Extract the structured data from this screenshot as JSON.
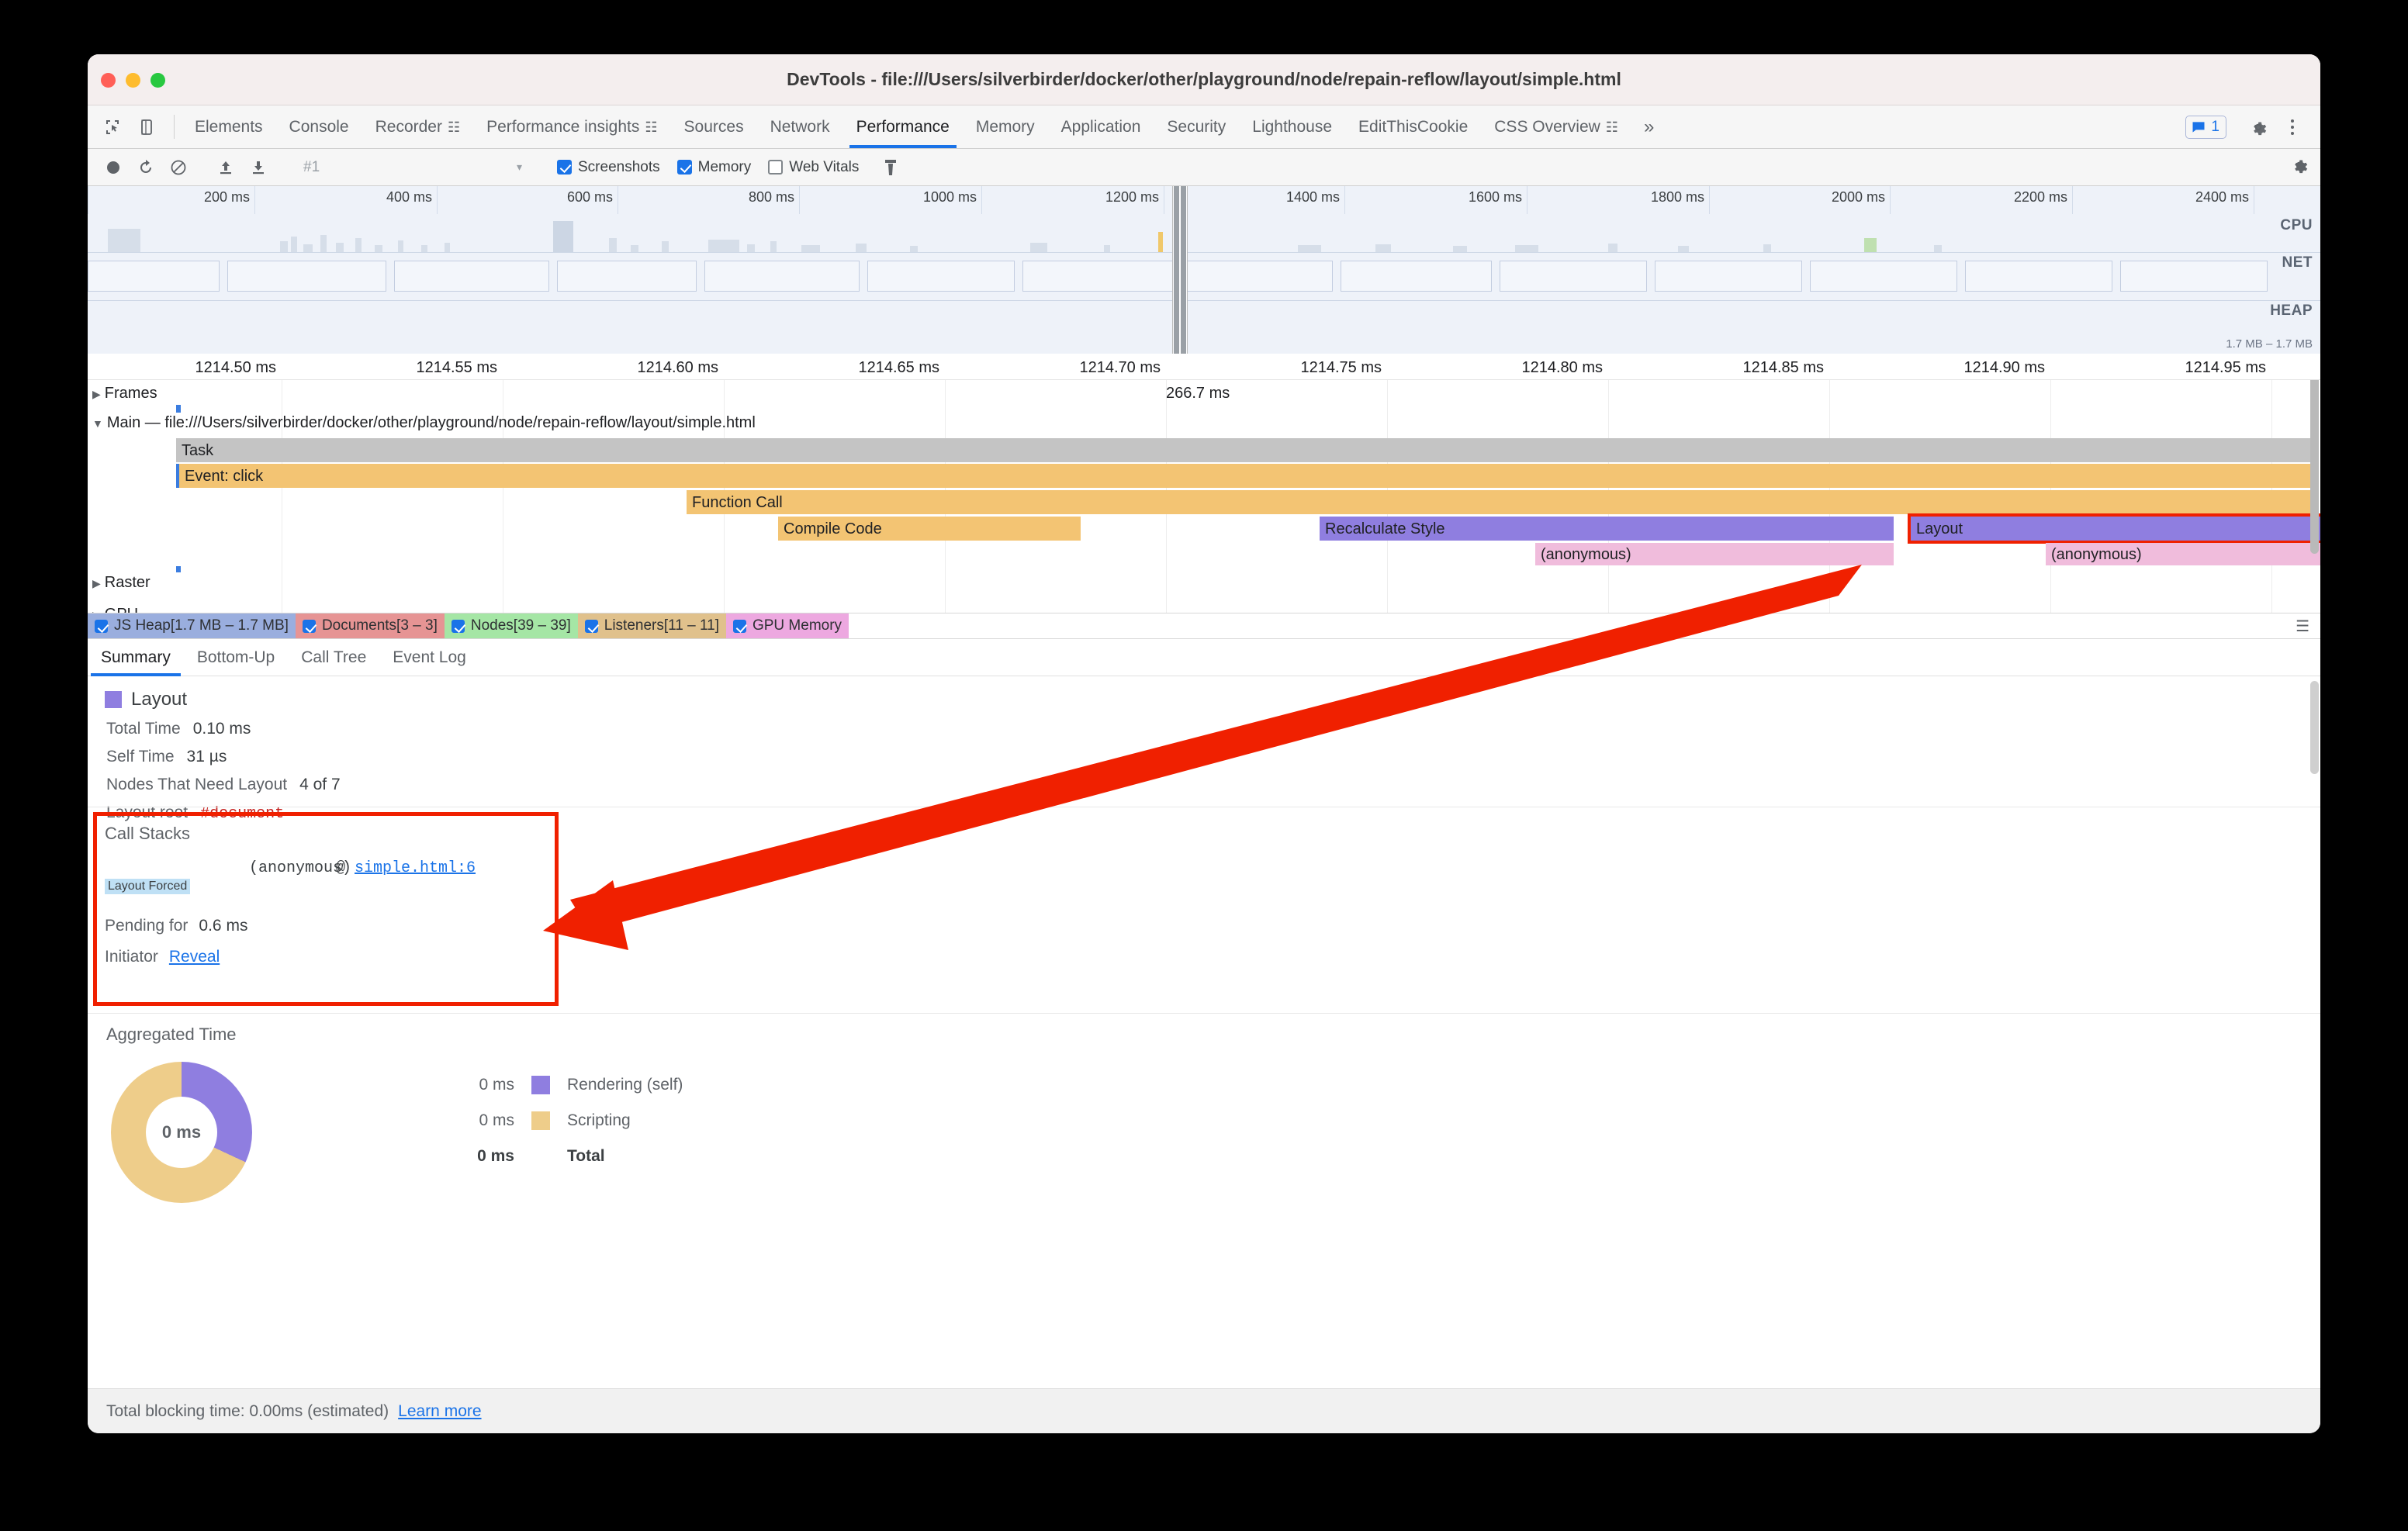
{
  "window": {
    "title": "DevTools - file:///Users/silverbirder/docker/other/playground/node/repain-reflow/layout/simple.html",
    "traffic_lights": [
      "close-red",
      "minimize-yellow",
      "maximize-green"
    ]
  },
  "main_tabs": {
    "icons": [
      "inspect-icon",
      "device-toolbar-icon"
    ],
    "items": [
      {
        "label": "Elements",
        "experimental": false
      },
      {
        "label": "Console",
        "experimental": false
      },
      {
        "label": "Recorder",
        "experimental": true
      },
      {
        "label": "Performance insights",
        "experimental": true
      },
      {
        "label": "Sources",
        "experimental": false
      },
      {
        "label": "Network",
        "experimental": false
      },
      {
        "label": "Performance",
        "experimental": false,
        "active": true
      },
      {
        "label": "Memory",
        "experimental": false
      },
      {
        "label": "Application",
        "experimental": false
      },
      {
        "label": "Security",
        "experimental": false
      },
      {
        "label": "Lighthouse",
        "experimental": false
      },
      {
        "label": "EditThisCookie",
        "experimental": false
      },
      {
        "label": "CSS Overview",
        "experimental": true
      }
    ],
    "overflow_label": "»",
    "message_count": "1",
    "right_icons": [
      "messages-icon",
      "gear-icon",
      "kebab-menu-icon"
    ]
  },
  "toolbar": {
    "icons": [
      "record-icon",
      "reload-and-record-icon",
      "clear-icon",
      "upload-profile-icon",
      "download-profile-icon",
      "trash-icon",
      "capture-settings-icon"
    ],
    "profile_select_value": "#1",
    "checkboxes": [
      {
        "label": "Screenshots",
        "checked": true
      },
      {
        "label": "Memory",
        "checked": true
      },
      {
        "label": "Web Vitals",
        "checked": false
      }
    ]
  },
  "overview": {
    "ticks": [
      "200 ms",
      "400 ms",
      "600 ms",
      "800 ms",
      "1000 ms",
      "1200 ms",
      "1400 ms",
      "1600 ms",
      "1800 ms",
      "2000 ms",
      "2200 ms",
      "2400 ms"
    ],
    "bands": [
      {
        "name": "CPU"
      },
      {
        "name": "NET"
      },
      {
        "name": "HEAP"
      }
    ],
    "heap_range": "1.7 MB – 1.7 MB"
  },
  "detail_ruler": {
    "ticks": [
      "1214.50 ms",
      "1214.55 ms",
      "1214.60 ms",
      "1214.65 ms",
      "1214.70 ms",
      "1214.75 ms",
      "1214.80 ms",
      "1214.85 ms",
      "1214.90 ms",
      "1214.95 ms"
    ]
  },
  "flame": {
    "tracks": [
      {
        "name": "Frames",
        "collapsed": true
      },
      {
        "name": "Main — file:///Users/silverbirder/docker/other/playground/node/repain-reflow/layout/simple.html",
        "collapsed": false
      },
      {
        "name": "Raster",
        "collapsed": true
      },
      {
        "name": "GPU",
        "collapsed": true
      }
    ],
    "frame_duration_label": "266.7 ms",
    "events": [
      {
        "label": "Task",
        "color": "grey"
      },
      {
        "label": "Event: click",
        "color": "yellow"
      },
      {
        "label": "Function Call",
        "color": "yellow"
      },
      {
        "label": "Compile Code",
        "color": "yellow"
      },
      {
        "label": "Recalculate Style",
        "color": "purple"
      },
      {
        "label": "(anonymous)",
        "color": "pink"
      },
      {
        "label": "Layout",
        "color": "purple",
        "selected": true
      },
      {
        "label": "(anonymous)",
        "color": "pink"
      }
    ]
  },
  "counters": [
    {
      "label": "JS Heap[1.7 MB – 1.7 MB]",
      "checked": true,
      "color": "#9aaede"
    },
    {
      "label": "Documents[3 – 3]",
      "checked": true,
      "color": "#e69494"
    },
    {
      "label": "Nodes[39 – 39]",
      "checked": true,
      "color": "#a5e6a5"
    },
    {
      "label": "Listeners[11 – 11]",
      "checked": true,
      "color": "#e0c18c"
    },
    {
      "label": "GPU Memory",
      "checked": true,
      "color": "#eda8e0"
    }
  ],
  "bottom_tabs": [
    {
      "label": "Summary",
      "active": true
    },
    {
      "label": "Bottom-Up",
      "active": false
    },
    {
      "label": "Call Tree",
      "active": false
    },
    {
      "label": "Event Log",
      "active": false
    }
  ],
  "summary": {
    "event_name": "Layout",
    "event_color": "#8f7ee0",
    "rows": [
      {
        "key": "Total Time",
        "value": "0.10 ms"
      },
      {
        "key": "Self Time",
        "value": "31 µs"
      },
      {
        "key": "Nodes That Need Layout",
        "value": "4 of 7"
      },
      {
        "key": "Layout root",
        "value": "#document",
        "value_style": "red-mono"
      }
    ],
    "call_stacks": {
      "title": "Call Stacks",
      "forced_label": "Layout Forced",
      "frame_fn": "(anonymous)",
      "frame_at": "@",
      "frame_link": "simple.html:6",
      "pending_key": "Pending for",
      "pending_value": "0.6 ms",
      "initiator_key": "Initiator",
      "initiator_link": "Reveal"
    }
  },
  "aggregated": {
    "title": "Aggregated Time",
    "center_label": "0 ms",
    "legend": [
      {
        "value": "0 ms",
        "label": "Rendering (self)",
        "color": "#8f7ee0"
      },
      {
        "value": "0 ms",
        "label": "Scripting",
        "color": "#eecd8a"
      }
    ],
    "total": {
      "value": "0 ms",
      "label": "Total"
    }
  },
  "footer": {
    "text": "Total blocking time: 0.00ms (estimated)",
    "link": "Learn more"
  },
  "chart_data": {
    "type": "pie",
    "title": "Aggregated Time",
    "categories": [
      "Rendering (self)",
      "Scripting"
    ],
    "values": [
      32,
      68
    ],
    "value_labels": [
      "0 ms",
      "0 ms"
    ],
    "colors": [
      "#8f7ee0",
      "#eecd8a"
    ],
    "total_label": "0 ms",
    "legend_position": "right",
    "donut": true
  }
}
